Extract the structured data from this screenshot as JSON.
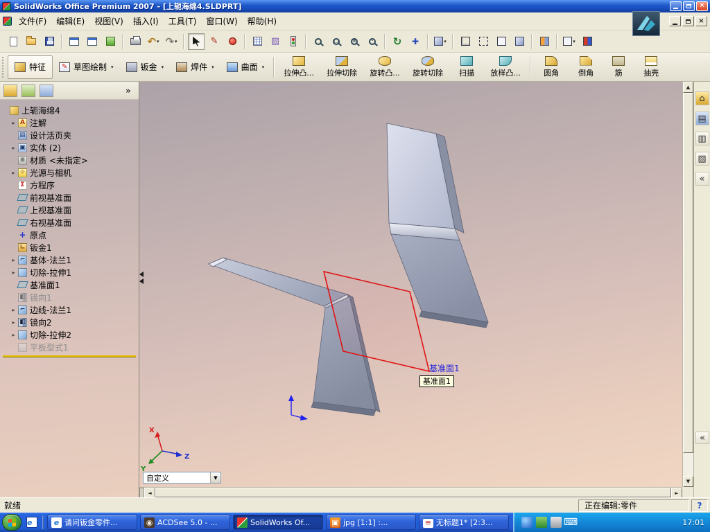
{
  "titlebar": {
    "title": "SolidWorks Office Premium 2007 - [上轭海绵4.SLDPRT]"
  },
  "menubar": {
    "items": [
      "文件(F)",
      "编辑(E)",
      "视图(V)",
      "插入(I)",
      "工具(T)",
      "窗口(W)",
      "帮助(H)"
    ]
  },
  "command_manager": {
    "tabs": [
      {
        "label": "特征"
      },
      {
        "label": "草图绘制"
      },
      {
        "label": "钣金"
      },
      {
        "label": "焊件"
      },
      {
        "label": "曲面"
      }
    ],
    "commands": [
      "拉伸凸...",
      "拉伸切除",
      "旋转凸...",
      "旋转切除",
      "扫描",
      "放样凸...",
      "圆角",
      "倒角",
      "筋",
      "抽壳"
    ]
  },
  "feature_tree": {
    "root": "上轭海绵4",
    "items": [
      {
        "label": "注解"
      },
      {
        "label": "设计活页夹"
      },
      {
        "label": "实体 (2)"
      },
      {
        "label": "材质 <未指定>"
      },
      {
        "label": "光源与相机"
      },
      {
        "label": "方程序"
      },
      {
        "label": "前视基准面"
      },
      {
        "label": "上视基准面"
      },
      {
        "label": "右视基准面"
      },
      {
        "label": "原点"
      },
      {
        "label": "钣金1"
      },
      {
        "label": "基体-法兰1"
      },
      {
        "label": "切除-拉伸1"
      },
      {
        "label": "基准面1"
      },
      {
        "label": "镜向1",
        "suppressed": true
      },
      {
        "label": "边线-法兰1"
      },
      {
        "label": "镜向2"
      },
      {
        "label": "切除-拉伸2"
      },
      {
        "label": "平板型式1",
        "suppressed": true
      }
    ]
  },
  "viewport": {
    "plane_label": "基准面1",
    "tooltip": "基准面1",
    "view_selector": "自定义",
    "triad": {
      "x": "X",
      "y": "Y",
      "z": "Z"
    }
  },
  "statusbar": {
    "left": "就绪",
    "right": "正在编辑:零件",
    "help": "?"
  },
  "taskbar": {
    "tasks": [
      {
        "label": "请问钣金零件..."
      },
      {
        "label": "ACDSee 5.0 - ..."
      },
      {
        "label": "SolidWorks Of..."
      },
      {
        "label": "jpg [1:1] :..."
      },
      {
        "label": "无标题1* [2:3..."
      }
    ],
    "clock": "17:01"
  },
  "colors": {
    "plane_edge": "#e11414",
    "plane_label": "#2222d8",
    "viewport_top": "#aca2a8",
    "viewport_bottom": "#f0d6c2",
    "taskbar_blue": "#2a58c8"
  },
  "icons": {
    "expand": "▸",
    "caret": "▾",
    "chevrons_left": "«",
    "chevrons_right": "»",
    "arrow_up": "▲",
    "arrow_down": "▼",
    "arrow_left": "◄",
    "arrow_right": "►",
    "undo": "↶",
    "redo": "↷",
    "rotate_view": "↻",
    "pan": "✚",
    "zoom_area_sign": "□",
    "zoom_inout_sign": "±",
    "zoom_sel_sign": "·",
    "close": "×",
    "question": "?",
    "home": "⌂",
    "design_library": "▤",
    "file_explorer": "▥",
    "search_tab": "▧",
    "annotation": "A",
    "design_binder": "▤",
    "solid_bodies": "▣",
    "material": "≡",
    "lights": "☼",
    "equations": "Σ",
    "origin_cross": "+",
    "sheet_metal": "∟",
    "flange": "⌐",
    "mirror": "◧",
    "sketch": "✎",
    "grid": "▦",
    "appearance": "▨",
    "ie": "e",
    "eye": "◉",
    "keyboard": "⌨",
    "image_tile": "▣",
    "doc_tile": "≡"
  }
}
